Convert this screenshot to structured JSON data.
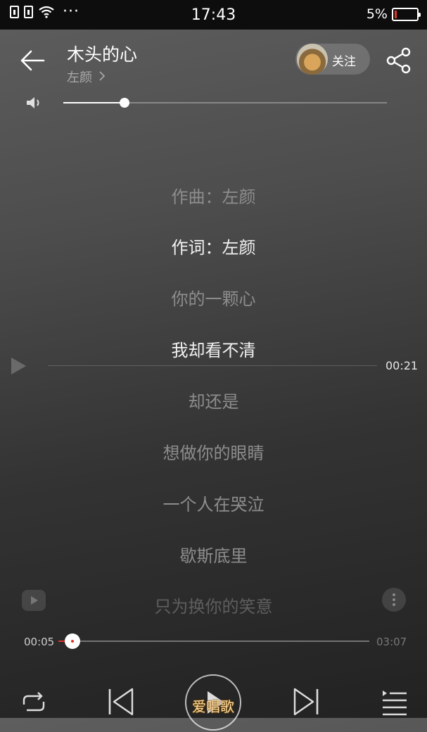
{
  "status_bar": {
    "time": "17:43",
    "battery": "5%"
  },
  "song": {
    "title": "木头的心",
    "artist": "左颜"
  },
  "follow": {
    "label": "关注"
  },
  "volume": {
    "level": 0.19
  },
  "lyrics": [
    {
      "text": "作曲：左颜",
      "style": "normal"
    },
    {
      "text": "作词：左颜",
      "style": "bright"
    },
    {
      "text": "你的一颗心",
      "style": "normal"
    },
    {
      "text": "我却看不清",
      "style": "bright"
    },
    {
      "text": "却还是",
      "style": "normal"
    },
    {
      "text": "想做你的眼睛",
      "style": "normal"
    },
    {
      "text": "一个人在哭泣",
      "style": "normal"
    },
    {
      "text": "歇斯底里",
      "style": "normal"
    },
    {
      "text": "只为换你的笑意",
      "style": "dim"
    }
  ],
  "seek_preview": {
    "time": "00:21"
  },
  "progress": {
    "current": "00:05",
    "total": "03:07",
    "fraction": 0.045
  },
  "watermark": "爱唱歌",
  "colors": {
    "accent": "#e0342b",
    "status_bar": "#0d0d0d"
  },
  "icons": [
    "back-arrow-icon",
    "chevron-right-icon",
    "share-icon",
    "volume-icon",
    "play-icon",
    "mv-icon",
    "more-vertical-icon",
    "repeat-icon",
    "previous-icon",
    "next-icon",
    "playlist-icon"
  ]
}
